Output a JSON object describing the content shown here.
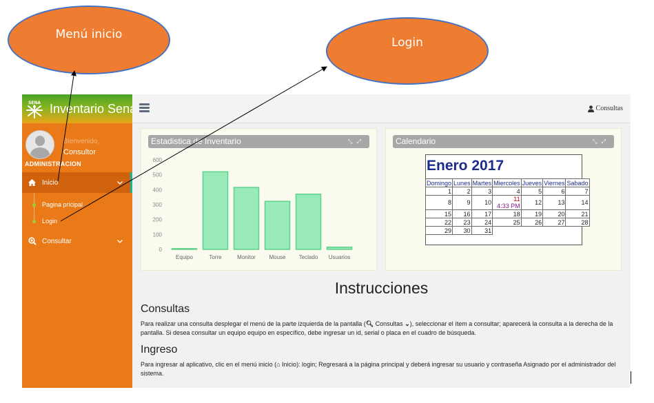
{
  "callouts": {
    "menu": "Menú inicio",
    "login": "Login"
  },
  "sidebar": {
    "brand": "Inventario Sena",
    "welcome": "Bienvenido,",
    "user": "Consultor",
    "role": "ADMINISTRACION",
    "inicio_label": "Inicio",
    "inicio_icon": "home-icon",
    "subitems": [
      "Pagina pricipal",
      "Login"
    ],
    "consultar_label": "Consultar",
    "consultar_icon": "search-plus-icon",
    "colors": {
      "bg": "#ea7a18",
      "active": "#d1620d",
      "accent": "#1ab394"
    }
  },
  "topbar": {
    "user_label": "Consultas"
  },
  "stats": {
    "title": "Estadistica de Inventario",
    "chart_data": {
      "type": "bar",
      "categories": [
        "Equipo",
        "Torre",
        "Monitor",
        "Mouse",
        "Teclado",
        "Usuarios"
      ],
      "values": [
        5,
        520,
        415,
        322,
        370,
        15
      ],
      "ylim": [
        0,
        600
      ],
      "yticks": [
        0,
        100,
        200,
        300,
        400,
        500,
        600
      ],
      "bar_color": "#98ebb8",
      "bar_border": "#5cd28a",
      "grid": false
    }
  },
  "calendar": {
    "title": "Calendario",
    "month": "Enero 2017",
    "weekdays": [
      "Domingo",
      "Lunes",
      "Martes",
      "Miercoles",
      "Jueves",
      "Viernes",
      "Sabado"
    ],
    "event_time": "4:33 PM",
    "today": 11
  },
  "instructions": {
    "title": "Instrucciones",
    "consultas_heading": "Consultas",
    "consultas_text_1": "Para realizar una consulta desplegar el menú de la parte izquierda de la pantalla (",
    "consultas_inline_label": "Consultas",
    "consultas_text_2": "), seleccionar el ítem a consultar; aparecerá la consulta a la derecha de la pantalla. Si desea consultar un equipo equipo en específico, debe ingresar un id, serial o placa en el cuadro de búsqueda.",
    "ingreso_heading": "Ingreso",
    "ingreso_text_1": "Para ingresar al aplicativo, clic en el menú inicio (",
    "ingreso_inline_label": "Inicio",
    "ingreso_text_2": "): login; Regresará a la página principal y deberá ingresar su usuario y contraseña Asignado por el administrador del sistema."
  }
}
